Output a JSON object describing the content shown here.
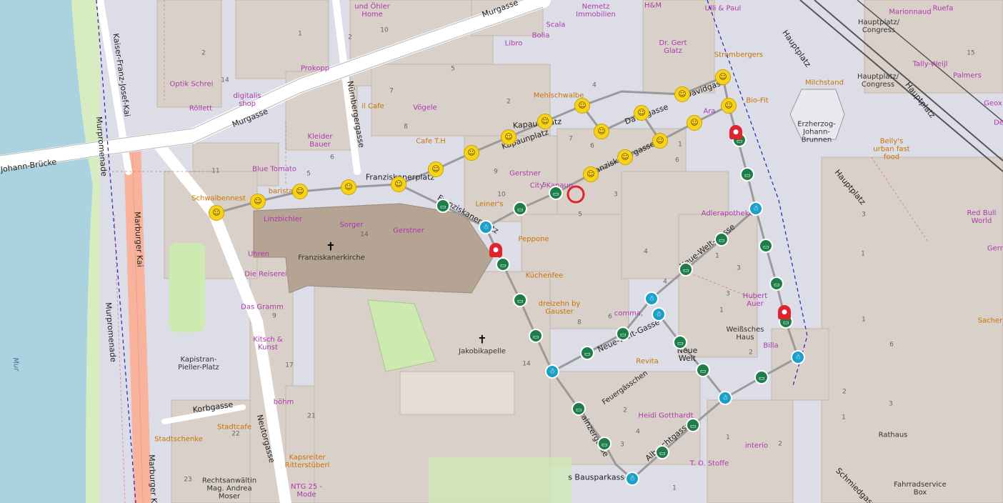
{
  "map": {
    "streets": {
      "murgasse_top": "Murgasse",
      "murgasse": "Murgasse",
      "bruecke": "Johann-Brücke",
      "kaiser_franz_josef_kai": "Kaiser-Franz-Josef-Kai",
      "murpromenade_1": "Murpromenade",
      "murpromenade_2": "Murpromenade",
      "marburger_kai": "Marburger Kai",
      "marburger_kai_bottom": "Marburger Kai",
      "nuernbergergasse": "Nürnbergergasse",
      "franziskanerplatz": "Franziskanerplatz",
      "franziskanerplatz_2": "Franziskanerplatz",
      "kapaunplatz": "Kapaunplatz",
      "kapaunplatz_2": "Kapaunplatz",
      "davidgasse": "Davidgasse",
      "davidgasse_2": "Davidgasse",
      "franziskanergasse": "Franziskanergasse",
      "neue_welt_gasse": "Neue-Welt-Gasse",
      "neue_welt_gasse_2": "Neue-Welt-Gasse",
      "neue_welt": "Neue Welt",
      "feuergaesschen": "Feuergässchen",
      "stainzergasse": "Stainzergasse",
      "albrechtgasse": "Albrechtgasse",
      "neutorgasse": "Neutorgasse",
      "korbgasse": "Korbgasse",
      "hauptplatz_1": "Hauptplatz",
      "hauptplatz_2": "Hauptplatz",
      "hauptplatz_3": "Hauptplatz",
      "schmiedgasse": "Schmiedgasse",
      "bausparkasse": "s Bausparkasse",
      "mur": "Mur"
    },
    "places": {
      "franziskanerkirche": "Franziskanerkirche",
      "jakobikapelle": "Jakobikapelle",
      "kapistran_platz": "Kapistran-Pieller-Platz",
      "erzherzog_brunnen": "Erzherzog-Johann-Brunnen",
      "weisses_haus": "Weißsches Haus",
      "rathaus": "Rathaus",
      "fahrradservice": "Fahrradservice Box",
      "hauptplatz_congress_1": "Hauptplatz/ Congress",
      "hauptplatz_congress_2": "Hauptplatz/ Congress",
      "red_bull": "Red Bull World"
    },
    "pois": {
      "und_ohler": "und Öhler Home",
      "nemetz": "Nemetz Immobilien",
      "hm": "H&M",
      "ulli_paul": "Ulli & Paul",
      "marionnaud": "Marionnaud",
      "ruefa": "Ruefa",
      "scala": "Scala",
      "bolia": "Bolia",
      "libro": "Libro",
      "dr_gert_glatz": "Dr. Gert Glatz",
      "prokopp": "Prokopp",
      "optik_schrei": "Optik Schrei",
      "digitalis_shop": "digitalis shop",
      "roellett": "Röllett",
      "mehlschwalbe": "Mehlschwalbe",
      "il_cafe": "il Cafe",
      "voegele": "Vögele",
      "kleider_bauer": "Kleider Bauer",
      "cafe_th": "Cafe T.H",
      "blue_tomato": "Blue Tomato",
      "schwalbennest": "Schwalbennest",
      "barista": "barista",
      "linzbichler": "Linzbichler",
      "sorger": "Sorger",
      "gerstner_1": "Gerstner",
      "gerstner_2": "Gerstner",
      "city_kapaun": "City Kapaun",
      "leiners": "Leiner's",
      "peppone": "Peppone",
      "kuechenfee": "Küchenfee",
      "dreizehn": "dreizehn by Gauster",
      "comma": "comma,",
      "revita": "Revita",
      "heidi_gotthardt": "Heidi Gotthardt",
      "interio": "interio",
      "to_stoffe": "T. O. Stoffe",
      "stadtschenke": "Stadtschenke",
      "stadtcafe": "Stadtcafe",
      "kapsreiter": "Kapsreiter Ritterstüberl",
      "ntg25": "NTG 25 - Mode",
      "rechtsanwaeltin": "Rechtsanwältin Mag. Andrea Moser",
      "kitsch_kunst": "Kitsch & Kunst",
      "das_gramm": "Das Gramm",
      "die_reiserei": "Die Reiserei",
      "uhren": "Uhren",
      "boehm": "böhm",
      "stromberger": "Strombergers",
      "bio_fit": "Bio-Fit",
      "milchstand": "Milchstand",
      "bellys": "Belly's urban fast food",
      "palmers": "Palmers",
      "tally_weijl": "Tally-Weijl",
      "geox": "Geox",
      "adlerapotheke": "Adlerapotheke",
      "hubert_auer": "Hubert Auer",
      "billa": "Billa",
      "sacher": "Sacher",
      "gern": "Gern",
      "ara": "Ara",
      "de": "De"
    },
    "house_numbers": [
      "10",
      "2",
      "1",
      "2",
      "14",
      "7",
      "8",
      "2",
      "5",
      "4",
      "6",
      "9",
      "10",
      "7",
      "6",
      "5",
      "1",
      "11",
      "14",
      "3",
      "6",
      "4",
      "5",
      "1",
      "2",
      "3",
      "4",
      "6",
      "8",
      "1",
      "2",
      "14",
      "3",
      "1",
      "2",
      "1",
      "2",
      "3",
      "1",
      "6",
      "1",
      "3",
      "4",
      "5",
      "15",
      "9",
      "21",
      "17",
      "22",
      "23",
      "1",
      "3"
    ],
    "colors": {
      "background": "#f2efe9",
      "building": "#d9d0c9",
      "pedestrian": "#dddde8",
      "water": "#aad3df",
      "church": "#b5a394",
      "grass": "#cdebb0",
      "road_primary": "#ffffff",
      "road_trunk": "#f9b29c",
      "rail": "#555555",
      "route": "#999999",
      "boundary": "#2020c0"
    },
    "markers": {
      "smiley_icon": "smiley-face",
      "green_icon": "bus-stop",
      "ghost_icon": "ghost",
      "red_icon": "alien",
      "selected_marker": "red-circle"
    }
  }
}
